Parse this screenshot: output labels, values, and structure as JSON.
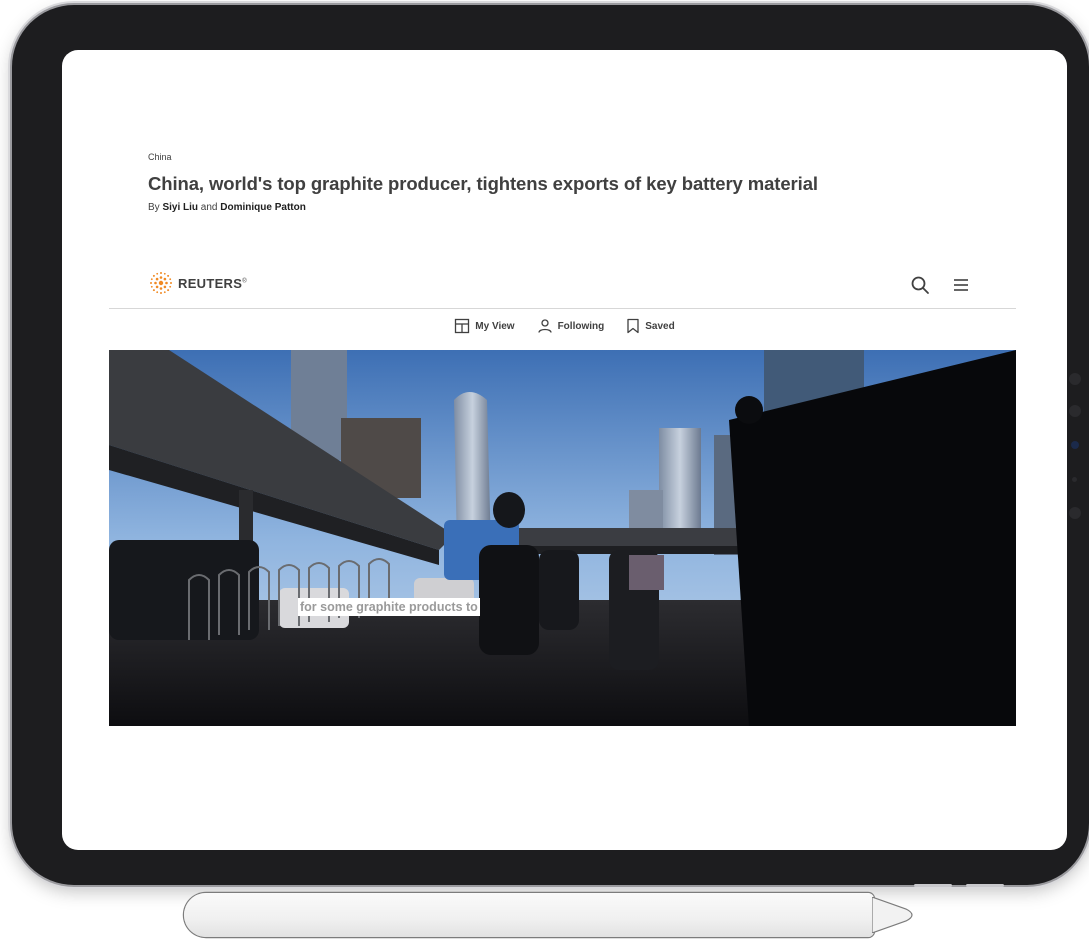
{
  "article": {
    "section": "China",
    "headline": "China, world's top graphite producer, tightens exports of key battery material",
    "byline_prefix": "By ",
    "author1": "Siyi Liu",
    "byline_and": " and ",
    "author2": "Dominique Patton"
  },
  "header": {
    "logo_text": "REUTERS",
    "logo_mark": "®",
    "search_icon": "search-icon",
    "menu_icon": "menu-icon"
  },
  "subnav": {
    "items": [
      {
        "label": "My View",
        "icon": "layout-icon"
      },
      {
        "label": "Following",
        "icon": "person-icon"
      },
      {
        "label": "Saved",
        "icon": "bookmark-icon"
      }
    ]
  },
  "video": {
    "caption": "for some graphite products to"
  },
  "colors": {
    "text": "#404040",
    "logo_orange": "#f08a24",
    "divider": "#d7d7d7"
  }
}
